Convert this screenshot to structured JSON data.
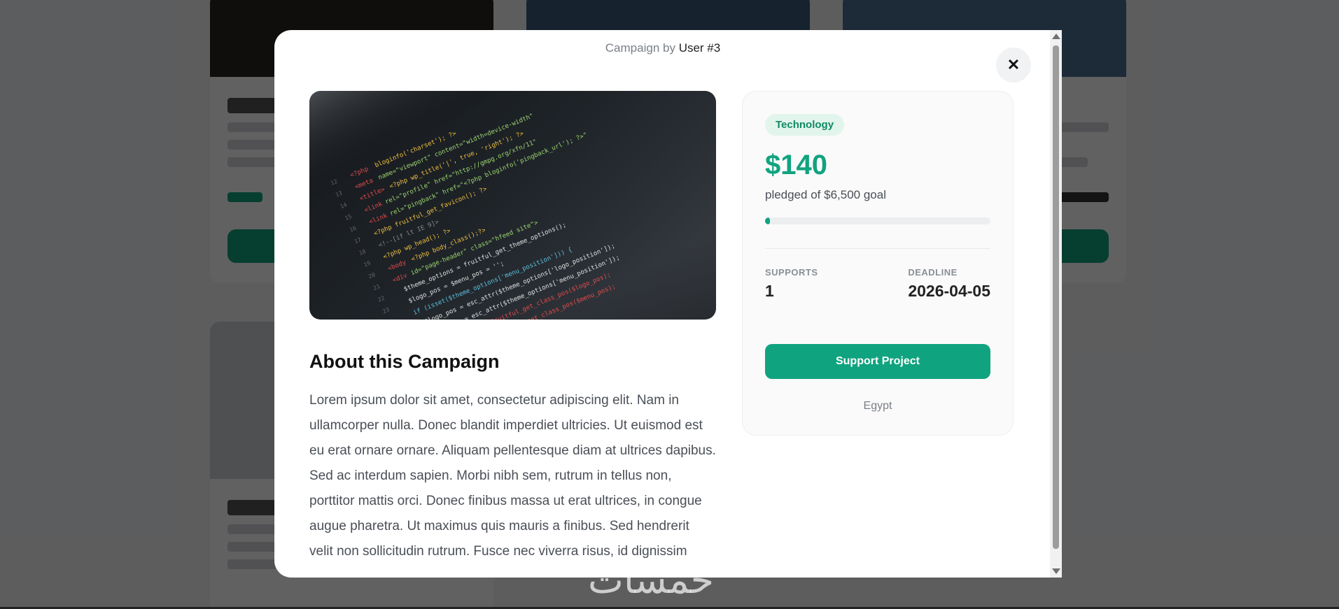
{
  "modal": {
    "header_prefix": "Campaign by",
    "header_author": "User #3",
    "close_glyph": "✕"
  },
  "about": {
    "title": "About this Campaign",
    "text": "Lorem ipsum dolor sit amet, consectetur adipiscing elit. Nam in ullamcorper nulla. Donec blandit imperdiet ultricies. Ut euismod est eu erat ornare ornare. Aliquam pellentesque diam at ultrices dapibus. Sed ac interdum sapien. Morbi nibh sem, rutrum in tellus non, porttitor mattis orci. Donec finibus massa ut erat ultrices, in congue augue pharetra. Ut maximus quis mauris a finibus. Sed hendrerit velit non sollicitudin rutrum. Fusce nec viverra risus, id dignissim nunc."
  },
  "sidebar": {
    "category": "Technology",
    "amount": "$140",
    "pledged_text": "pledged of $6,500 goal",
    "progress_fraction": 0.022,
    "supports_label": "SUPPORTS",
    "supports_value": "1",
    "deadline_label": "DEADLINE",
    "deadline_value": "2026-04-05",
    "support_button": "Support Project",
    "location": "Egypt"
  },
  "watermark": "خمسات",
  "colors": {
    "accent": "#10a37f",
    "badge_bg": "#e1f5ec"
  },
  "icons": {
    "close": "close-icon",
    "scroll_up": "scroll-up-arrow-icon",
    "scroll_down": "scroll-down-arrow-icon"
  }
}
